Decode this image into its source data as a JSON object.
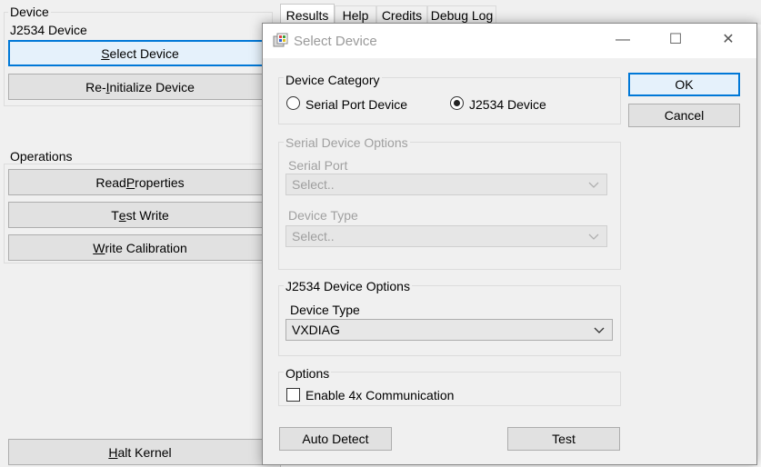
{
  "main": {
    "device_group_title": "Device",
    "device_name": "J2534 Device",
    "select_device_pre": "",
    "select_device_u": "S",
    "select_device_post": "elect Device",
    "reinit_pre": "Re-",
    "reinit_u": "I",
    "reinit_post": "nitialize Device",
    "operations_title": "Operations",
    "read_pre": "Read ",
    "read_u": "P",
    "read_post": "roperties",
    "test_pre": "T",
    "test_u": "e",
    "test_post": "st Write",
    "write_pre": "",
    "write_u": "W",
    "write_post": "rite Calibration",
    "halt_pre": "",
    "halt_u": "H",
    "halt_post": "alt Kernel"
  },
  "tabs": [
    "Results",
    "Help",
    "Credits",
    "Debug Log"
  ],
  "dialog": {
    "title": "Select Device",
    "minimize": "—",
    "maximize": "☐",
    "close": "✕",
    "ok_label": "OK",
    "cancel_label": "Cancel",
    "category_title": "Device Category",
    "radio_serial": "Serial Port Device",
    "radio_j2534": "J2534 Device",
    "serial_options_title": "Serial Device Options",
    "serial_port_label": "Serial Port",
    "serial_port_value": "Select..",
    "serial_device_type_label": "Device Type",
    "serial_device_type_value": "Select..",
    "j2534_options_title": "J2534 Device Options",
    "j2534_device_type_label": "Device Type",
    "j2534_device_type_value": "VXDIAG",
    "options_title": "Options",
    "enable_4x_label": "Enable 4x Communication",
    "auto_detect_label": "Auto Detect",
    "test_label": "Test"
  },
  "colors": {
    "accent": "#0078d7",
    "button_bg": "#e1e1e1",
    "window_bg": "#f0f0f0"
  },
  "icons": {
    "app": "app-icon",
    "chevron": "chevron-down-icon"
  }
}
